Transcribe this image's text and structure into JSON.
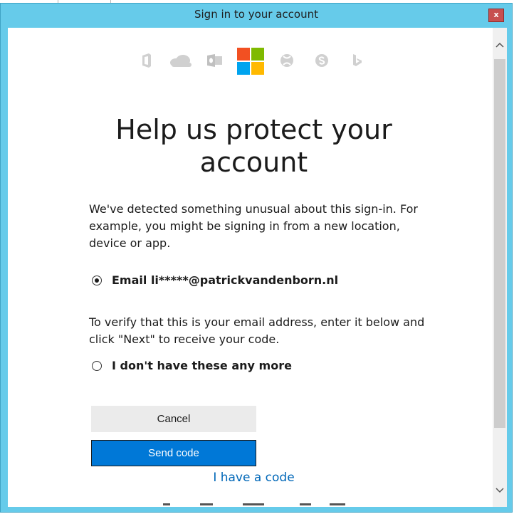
{
  "window": {
    "title": "Sign in to your account",
    "close_label": "x"
  },
  "product_icons": [
    "office-icon",
    "onedrive-icon",
    "outlook-icon",
    "microsoft-logo",
    "xbox-icon",
    "skype-icon",
    "bing-icon"
  ],
  "main": {
    "heading_line1": "Help us protect your",
    "heading_line2": "account",
    "intro": "We've detected something unusual about this sign-in. For example, you might be signing in from a new location, device or app.",
    "option_email": "Email li*****@patrickvandenborn.nl",
    "verify_text": "To verify that this is your email address, enter it below and click \"Next\" to receive your code.",
    "option_none": "I don't have these any more",
    "cancel_label": "Cancel",
    "send_label": "Send code",
    "have_code_label": "I have a code"
  },
  "colors": {
    "titlebar": "#66cbea",
    "primary_button": "#0078d7",
    "link": "#0067b8",
    "ms_red": "#f25022",
    "ms_green": "#7fba00",
    "ms_blue": "#00a4ef",
    "ms_yellow": "#ffb900"
  }
}
